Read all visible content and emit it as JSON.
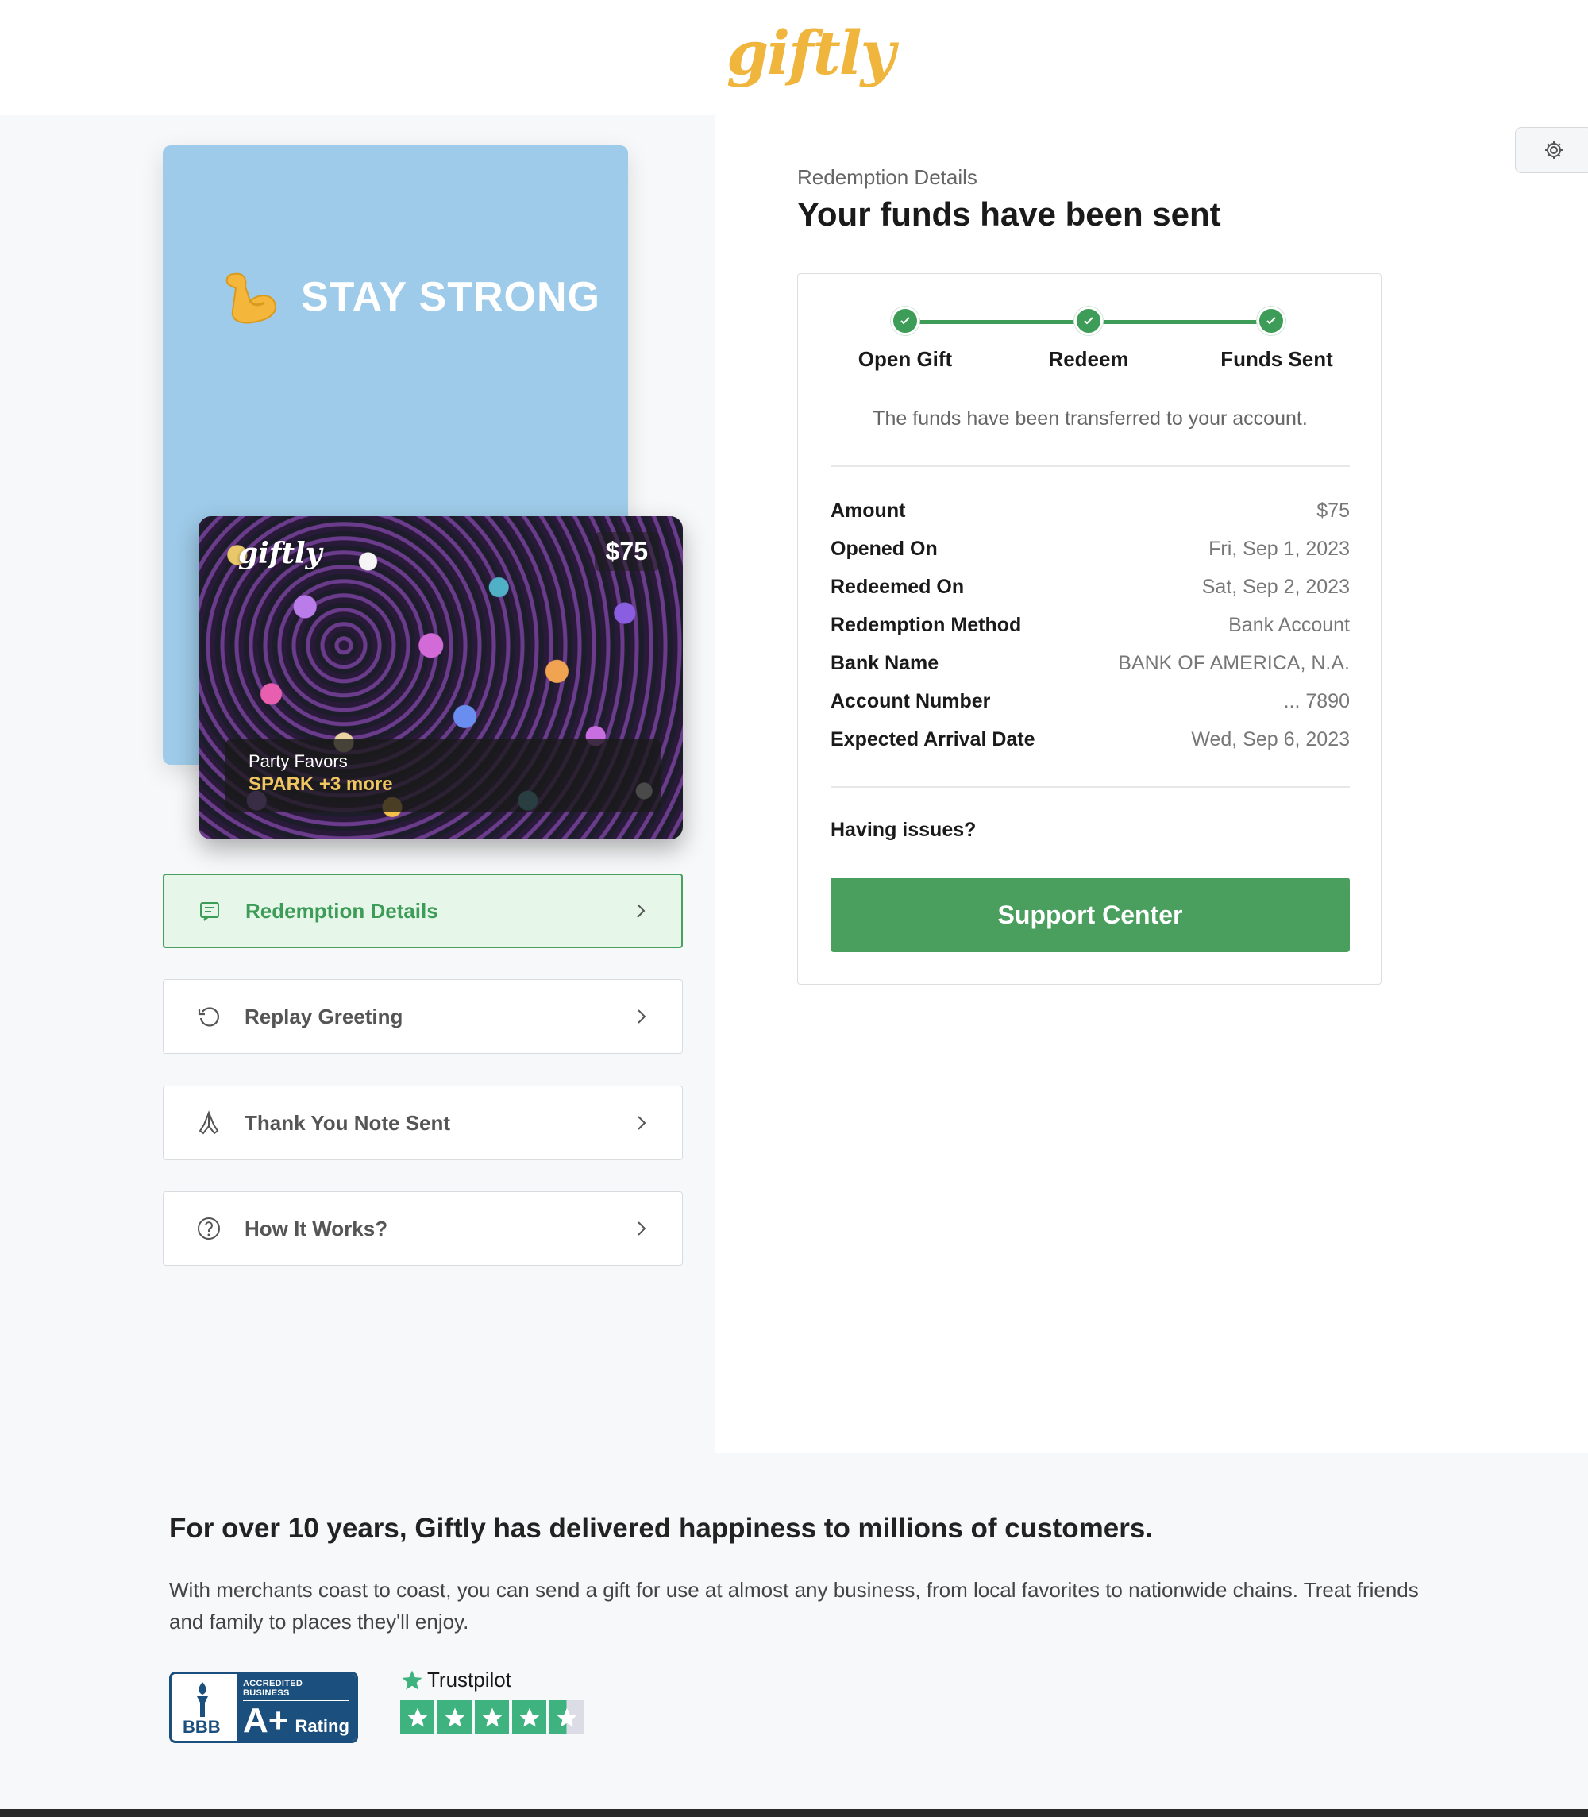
{
  "header": {
    "logo": "giftly"
  },
  "greeting": {
    "text": "STAY STRONG",
    "emoji": "flexed-biceps"
  },
  "gift_card": {
    "logo": "giftly",
    "amount": "$75",
    "subtitle": "Party Favors",
    "merchant": "SPARK +3 more"
  },
  "menu": [
    {
      "label": "Redemption Details",
      "icon": "receipt-icon",
      "active": true
    },
    {
      "label": "Replay Greeting",
      "icon": "replay-icon",
      "active": false
    },
    {
      "label": "Thank You Note Sent",
      "icon": "praying-hands-icon",
      "active": false
    },
    {
      "label": "How It Works?",
      "icon": "question-icon",
      "active": false
    }
  ],
  "details": {
    "eyebrow": "Redemption Details",
    "title": "Your funds have been sent",
    "steps": [
      "Open Gift",
      "Redeem",
      "Funds Sent"
    ],
    "message": "The funds have been transferred to your account.",
    "rows": [
      {
        "label": "Amount",
        "value": "$75"
      },
      {
        "label": "Opened On",
        "value": "Fri, Sep 1, 2023"
      },
      {
        "label": "Redeemed On",
        "value": "Sat, Sep 2, 2023"
      },
      {
        "label": "Redemption Method",
        "value": "Bank Account"
      },
      {
        "label": "Bank Name",
        "value": "BANK OF AMERICA, N.A."
      },
      {
        "label": "Account Number",
        "value": "... 7890"
      },
      {
        "label": "Expected Arrival Date",
        "value": "Wed, Sep 6, 2023"
      }
    ],
    "issues": "Having issues?",
    "support_button": "Support Center"
  },
  "footer": {
    "heading": "For over 10 years, Giftly has delivered happiness to millions of customers.",
    "text": "With merchants coast to coast, you can send a gift for use at almost any business, from local favorites to nationwide chains. Treat friends and family to places they'll enjoy.",
    "bbb": {
      "accredited": "ACCREDITED BUSINESS",
      "grade": "A+",
      "rating": "Rating",
      "letters": "BBB"
    },
    "trustpilot": {
      "name": "Trustpilot",
      "stars": 4.5
    }
  },
  "colors": {
    "brand_gold": "#f0b53c",
    "success_green": "#4a9f5f",
    "card_blue": "#9ecbe9"
  }
}
